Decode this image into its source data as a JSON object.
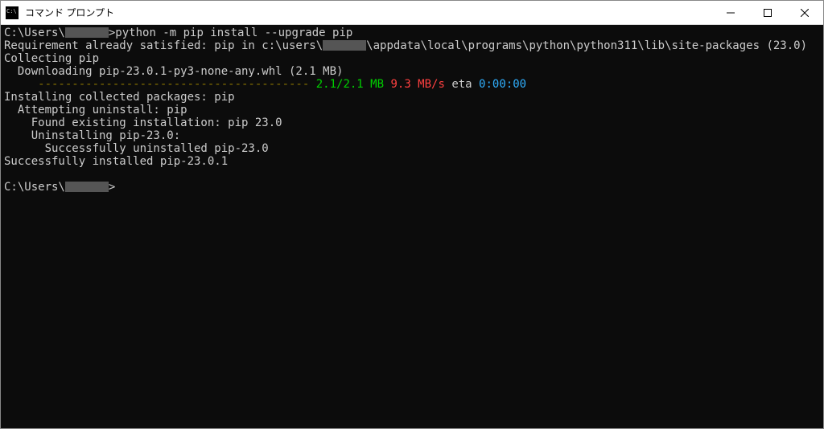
{
  "titlebar": {
    "title": "コマンド プロンプト"
  },
  "terminal": {
    "prompt_prefix": "C:\\Users\\",
    "prompt_suffix": ">",
    "command": "python -m pip install --upgrade pip",
    "line_requirement_a": "Requirement already satisfied: pip in c:\\users\\",
    "line_requirement_b": "\\appdata\\local\\programs\\python\\python311\\lib\\site-packages (23.0)",
    "line_collecting": "Collecting pip",
    "line_downloading": "  Downloading pip-23.0.1-py3-none-any.whl (2.1 MB)",
    "progress": {
      "bar": "     ---------------------------------------- ",
      "done": "2.1/2.1 MB",
      "speed": " 9.3 MB/s",
      "eta_label": " eta ",
      "eta": "0:00:00"
    },
    "line_installing": "Installing collected packages: pip",
    "line_attempting": "  Attempting uninstall: pip",
    "line_found": "    Found existing installation: pip 23.0",
    "line_uninstalling": "    Uninstalling pip-23.0:",
    "line_uninstalled": "      Successfully uninstalled pip-23.0",
    "line_success": "Successfully installed pip-23.0.1",
    "blank": ""
  }
}
